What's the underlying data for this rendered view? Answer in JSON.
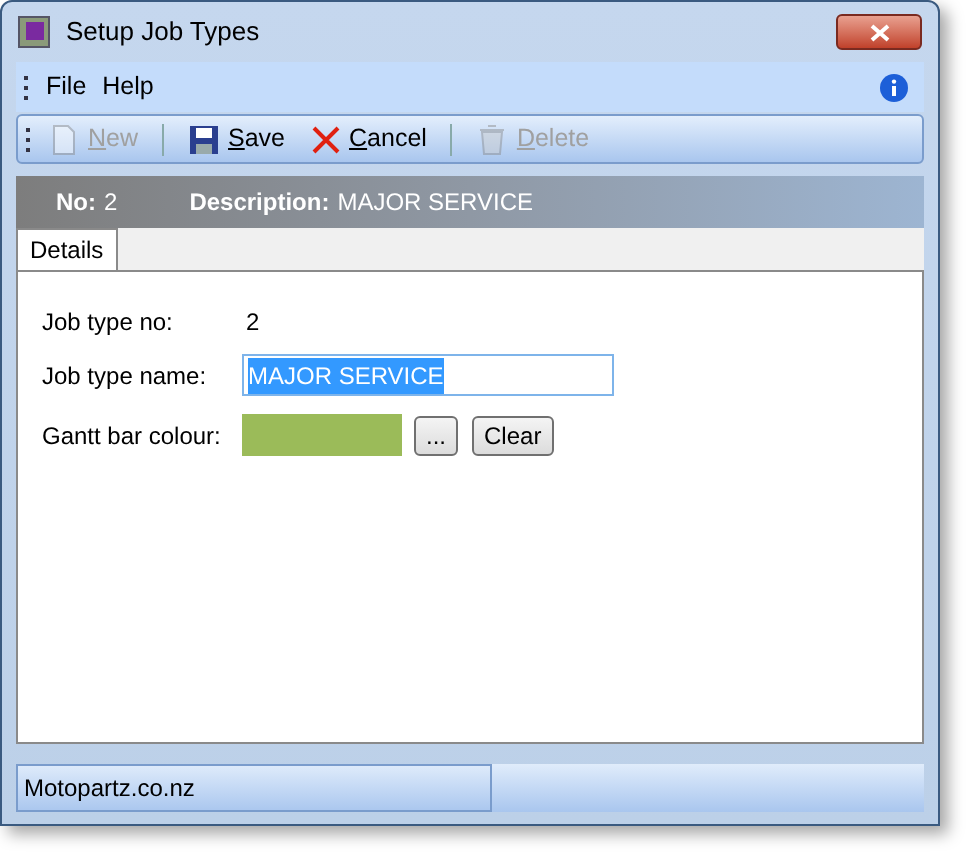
{
  "window": {
    "title": "Setup Job Types"
  },
  "menu": [
    {
      "label": "File"
    },
    {
      "label": "Help"
    }
  ],
  "toolbar": [
    {
      "label": "New",
      "kind": "new",
      "disabled": true
    },
    {
      "label": "Save",
      "kind": "save",
      "disabled": false
    },
    {
      "label": "Cancel",
      "kind": "cancel",
      "disabled": false
    },
    {
      "label": "Delete",
      "kind": "delete",
      "disabled": true
    }
  ],
  "header": [
    {
      "label": "No:",
      "value": "2"
    },
    {
      "label": "Description:",
      "value": "MAJOR SERVICE"
    }
  ],
  "tabs": [
    {
      "label": "Details",
      "selected": true
    }
  ],
  "form": {
    "job_type_no": {
      "label": "Job type no:",
      "value": "2"
    },
    "job_type_name": {
      "label": "Job type name:",
      "value": "MAJOR SERVICE",
      "text_selected": true
    },
    "gantt_bar_colour": {
      "label": "Gantt bar colour:",
      "color": "#9bbb59",
      "browse_button": "...",
      "clear_button": "Clear"
    }
  },
  "status_bar": {
    "text": "Motopartz.co.nz"
  }
}
